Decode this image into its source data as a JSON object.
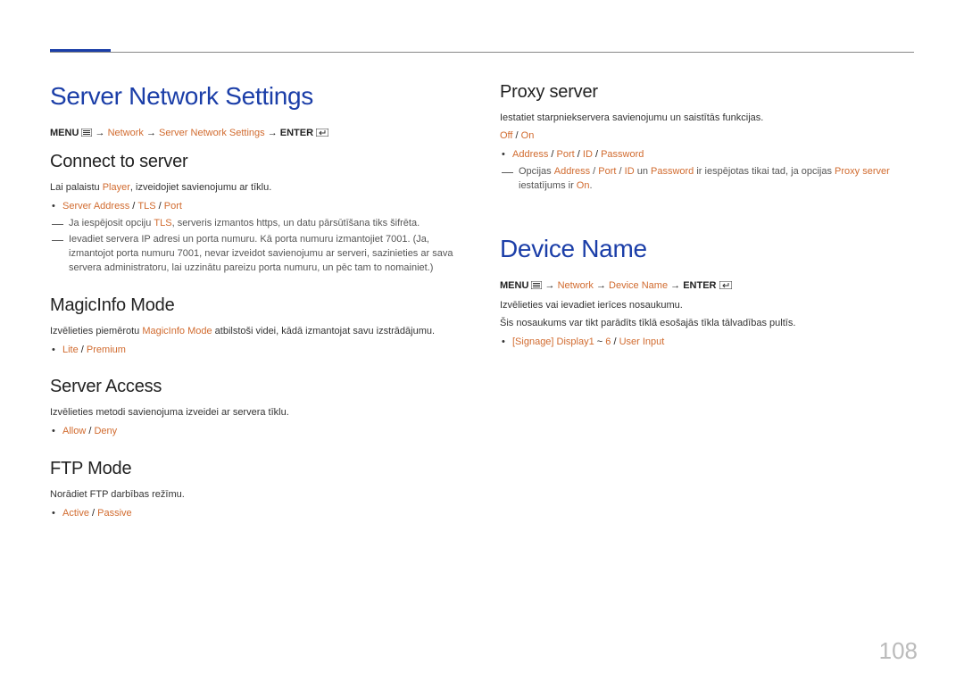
{
  "page_number": "108",
  "left": {
    "h1": "Server Network Settings",
    "crumb": {
      "pre": "MENU ",
      "arrow": " → ",
      "network": "Network",
      "sns": "Server Network Settings",
      "enter": " ENTER "
    },
    "connect": {
      "title": "Connect to server",
      "p1_a": "Lai palaistu ",
      "p1_b": "Player",
      "p1_c": ", izveidojiet savienojumu ar tīklu.",
      "bullet_a": "Server Address",
      "bullet_b": "TLS",
      "bullet_c": "Port",
      "sep": " / ",
      "dash1_a": "Ja iespējosit opciju ",
      "dash1_b": "TLS",
      "dash1_c": ", serveris izmantos https, un datu pārsūtīšana tiks šifrēta.",
      "dash2": "Ievadiet servera IP adresi un porta numuru. Kā porta numuru izmantojiet 7001. (Ja, izmantojot porta numuru 7001, nevar izveidot savienojumu ar serveri, sazinieties ar sava servera administratoru, lai uzzinātu pareizu porta numuru, un pēc tam to nomainiet.)"
    },
    "magic": {
      "title": "MagicInfo Mode",
      "p_a": "Izvēlieties piemērotu ",
      "p_b": "MagicInfo Mode",
      "p_c": " atbilstoši videi, kādā izmantojat savu izstrādājumu.",
      "bullet_a": "Lite",
      "bullet_b": "Premium",
      "sep": " / "
    },
    "access": {
      "title": "Server Access",
      "p": "Izvēlieties metodi savienojuma izveidei ar servera tīklu.",
      "bullet_a": "Allow",
      "bullet_b": "Deny",
      "sep": " / "
    },
    "ftp": {
      "title": "FTP Mode",
      "p": "Norādiet FTP darbības režīmu.",
      "bullet_a": "Active",
      "bullet_b": "Passive",
      "sep": " / "
    }
  },
  "right": {
    "proxy": {
      "title": "Proxy server",
      "p": "Iestatiet starpniekservera savienojumu un saistītās funkcijas.",
      "onoff_a": "Off",
      "onoff_b": "On",
      "sep": " / ",
      "bullet_a": "Address",
      "bullet_b": "Port",
      "bullet_c": "ID",
      "bullet_d": "Password",
      "dash_a": "Opcijas ",
      "dash_b": "Address",
      "dash_c": "Port",
      "dash_d": "ID",
      "dash_e": " un ",
      "dash_f": "Password",
      "dash_g": " ir iespējotas tikai tad, ja opcijas ",
      "dash_h": "Proxy server",
      "dash_i": " iestatījums ir ",
      "dash_j": "On",
      "dash_k": "."
    },
    "device": {
      "h1": "Device Name",
      "crumb_dn": "Device Name",
      "p1": "Izvēlieties vai ievadiet ierīces nosaukumu.",
      "p2": "Šis nosaukums var tikt parādīts tīklā esošajās tīkla tālvadības pultīs.",
      "bullet_a": "[Signage] Display1",
      "bullet_mid": " ~ ",
      "bullet_b": "6",
      "sep": " / ",
      "bullet_c": "User Input"
    }
  }
}
